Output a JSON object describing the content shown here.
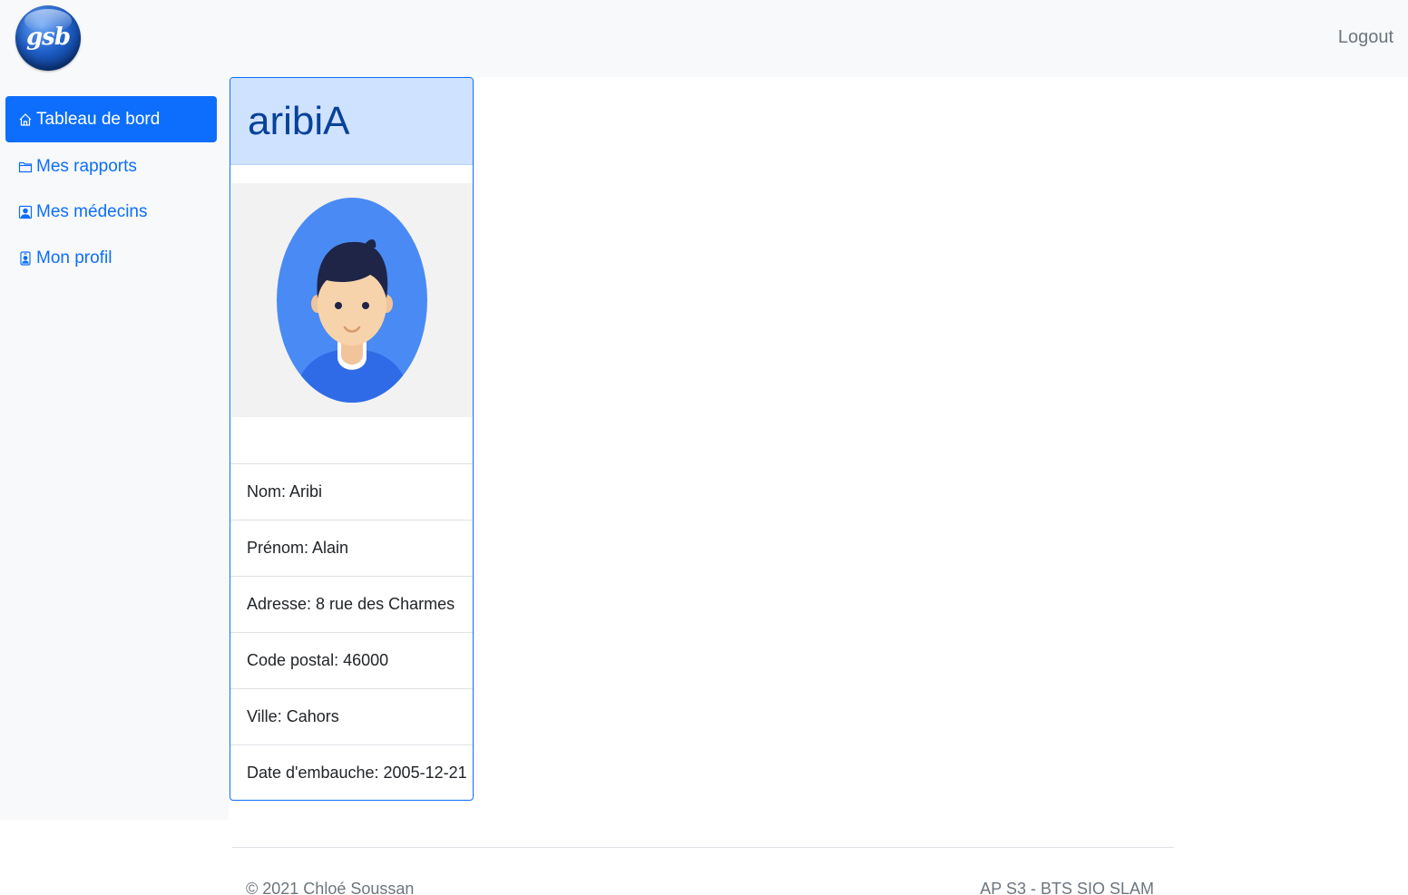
{
  "navbar": {
    "logo_text": "gsb",
    "logout_label": "Logout"
  },
  "sidebar": {
    "items": [
      {
        "label": "Tableau de bord",
        "icon": "house-icon",
        "active": true
      },
      {
        "label": "Mes rapports",
        "icon": "folder-icon",
        "active": false
      },
      {
        "label": "Mes médecins",
        "icon": "person-square-icon",
        "active": false
      },
      {
        "label": "Mon profil",
        "icon": "person-badge-icon",
        "active": false
      }
    ]
  },
  "profile": {
    "username": "aribiA",
    "fields": [
      "Nom: Aribi",
      "Prénom: Alain",
      "Adresse: 8 rue des Charmes",
      "Code postal: 46000",
      "Ville: Cahors",
      "Date d'embauche: 2005-12-21"
    ]
  },
  "footer": {
    "left": "© 2021 Chloé Soussan",
    "right": "AP S3 - BTS SIO SLAM"
  },
  "colors": {
    "primary": "#0d6efd",
    "header_bg": "#cfe2ff",
    "sidebar_bg": "#f8f9fa",
    "avatar_bg": "#4a8af4"
  }
}
